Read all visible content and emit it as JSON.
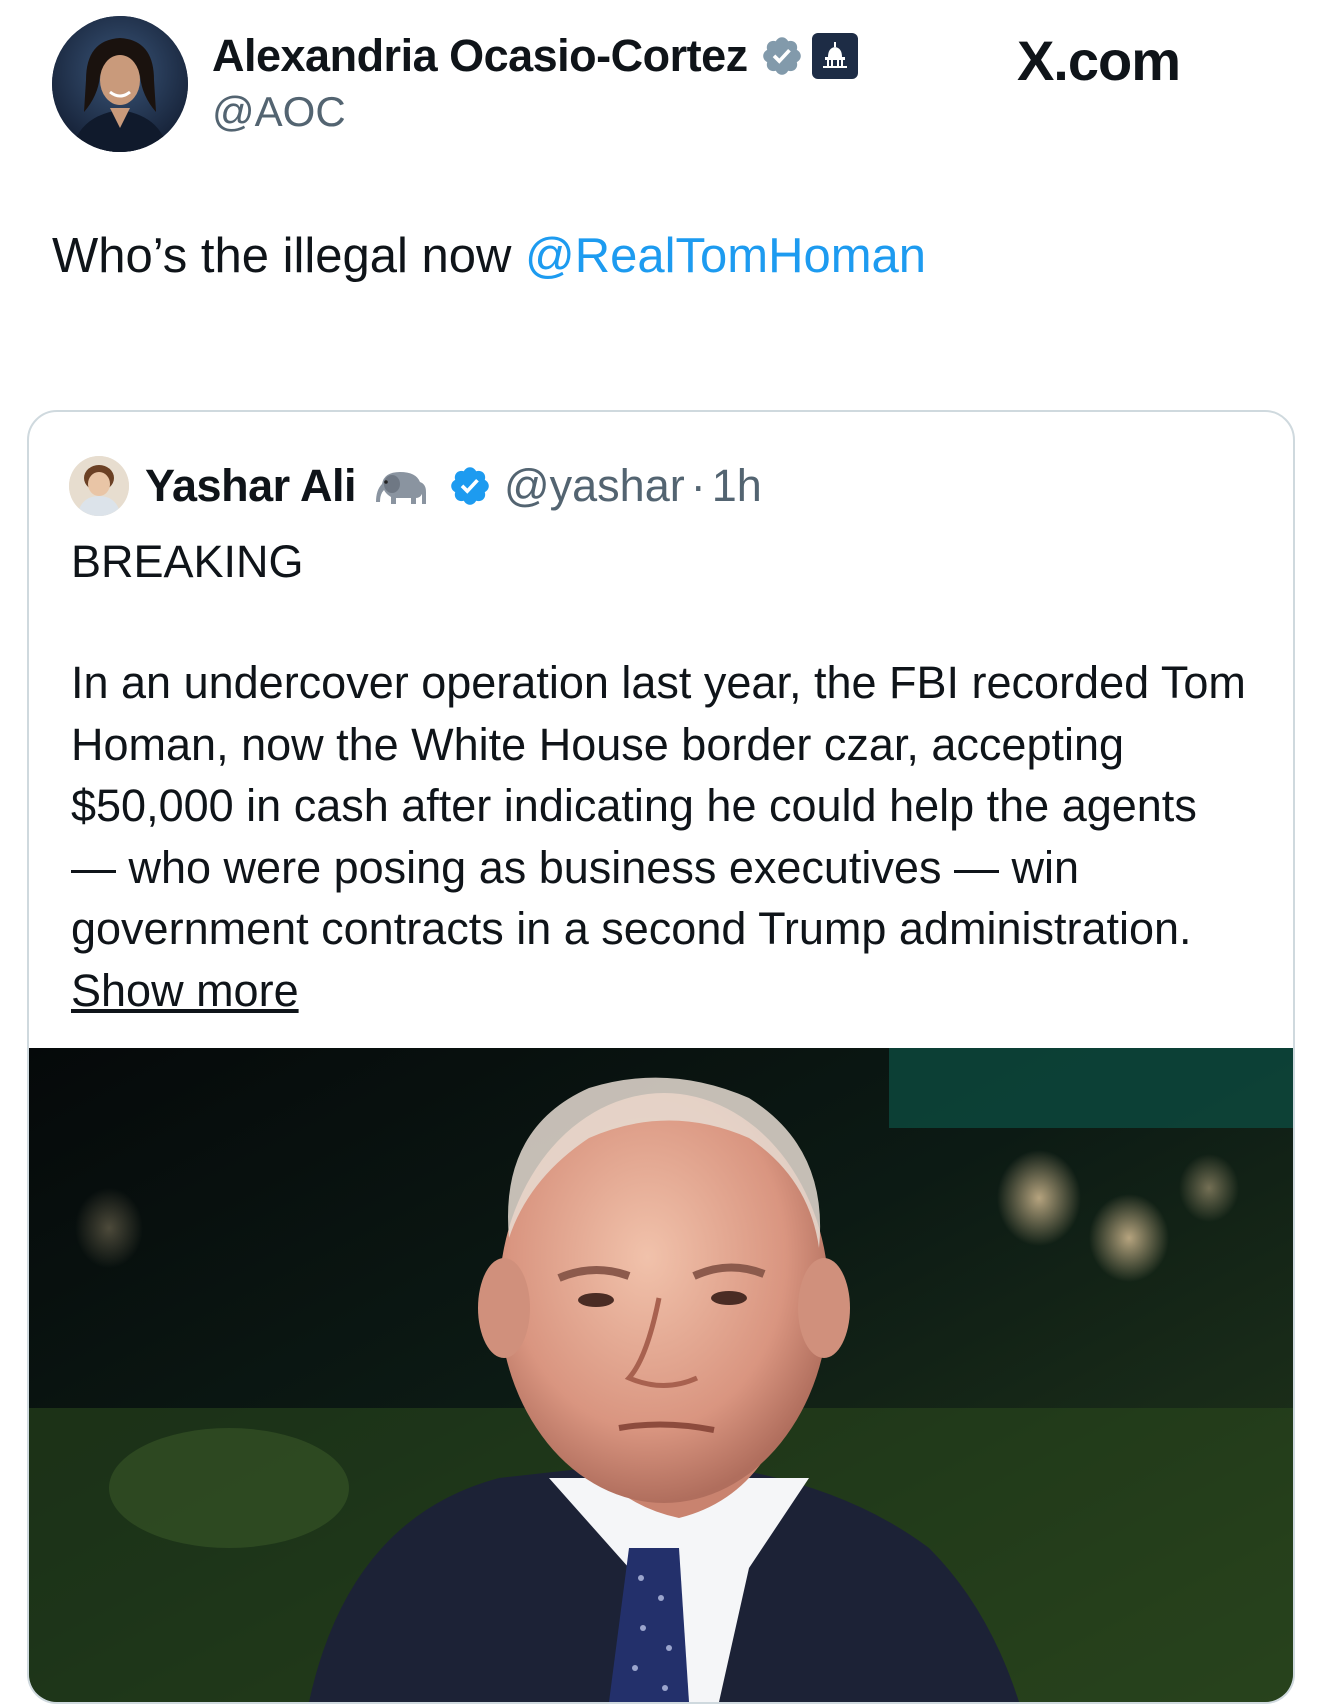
{
  "site": {
    "label": "X.com"
  },
  "author": {
    "name": "Alexandria Ocasio-Cortez",
    "handle": "@AOC"
  },
  "tweet": {
    "text_before": "Who’s the illegal now ",
    "mention": "@RealTomHoman"
  },
  "quoted": {
    "name": "Yashar Ali",
    "name_emoji": "elephant-icon",
    "handle": "@yashar",
    "separator": "·",
    "time": "1h",
    "headline": "BREAKING",
    "body": "In an undercover operation last year, the FBI recorded Tom Homan, now the White House border czar, accepting $50,000 in cash after indicating he could help the agents — who were posing as business executives — win government contracts in a second Trump administration.",
    "show_more": "Show more"
  },
  "icons": {
    "author_verified": "verified-badge-grey-icon",
    "government_affiliation": "capitol-dome-badge-icon",
    "quoted_verified": "verified-badge-blue-icon"
  },
  "colors": {
    "text": "#0f1419",
    "muted": "#536471",
    "link": "#1d9bf0",
    "border": "#cfd9de",
    "verified_blue": "#1d9bf0",
    "verified_grey": "#829aab"
  }
}
